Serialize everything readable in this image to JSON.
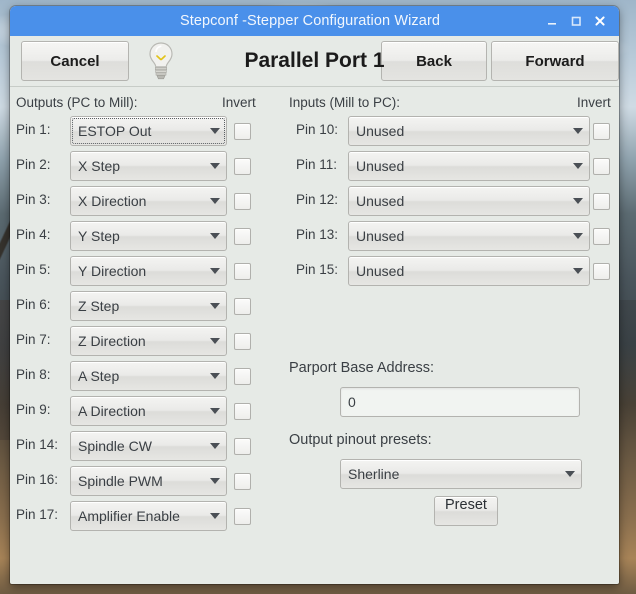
{
  "window": {
    "title": "Stepconf -Stepper Configuration Wizard",
    "minimize_label": "minimize",
    "maximize_label": "maximize",
    "close_label": "close",
    "titlebar_color": "#4a90ea",
    "panel_color": "#e6eae6"
  },
  "toolbar": {
    "cancel_label": "Cancel",
    "back_label": "Back",
    "forward_label": "Forward",
    "page_title": "Parallel Port 1",
    "bulb_icon": "lightbulb-icon"
  },
  "outputs": {
    "heading": "Outputs (PC to Mill):",
    "invert_heading": "Invert",
    "rows": [
      {
        "pin": "Pin 1:",
        "value": "ESTOP Out",
        "invert": false,
        "focused": true
      },
      {
        "pin": "Pin 2:",
        "value": "X Step",
        "invert": false,
        "focused": false
      },
      {
        "pin": "Pin 3:",
        "value": "X Direction",
        "invert": false,
        "focused": false
      },
      {
        "pin": "Pin 4:",
        "value": "Y Step",
        "invert": false,
        "focused": false
      },
      {
        "pin": "Pin 5:",
        "value": "Y Direction",
        "invert": false,
        "focused": false
      },
      {
        "pin": "Pin 6:",
        "value": "Z Step",
        "invert": false,
        "focused": false
      },
      {
        "pin": "Pin 7:",
        "value": "Z Direction",
        "invert": false,
        "focused": false
      },
      {
        "pin": "Pin 8:",
        "value": "A Step",
        "invert": false,
        "focused": false
      },
      {
        "pin": "Pin 9:",
        "value": "A Direction",
        "invert": false,
        "focused": false
      },
      {
        "pin": "Pin 14:",
        "value": "Spindle CW",
        "invert": false,
        "focused": false
      },
      {
        "pin": "Pin 16:",
        "value": "Spindle PWM",
        "invert": false,
        "focused": false
      },
      {
        "pin": "Pin 17:",
        "value": "Amplifier Enable",
        "invert": false,
        "focused": false
      }
    ]
  },
  "inputs": {
    "heading": "Inputs (Mill to PC):",
    "invert_heading": "Invert",
    "rows": [
      {
        "pin": "Pin 10:",
        "value": "Unused",
        "invert": false
      },
      {
        "pin": "Pin 11:",
        "value": "Unused",
        "invert": false
      },
      {
        "pin": "Pin 12:",
        "value": "Unused",
        "invert": false
      },
      {
        "pin": "Pin 13:",
        "value": "Unused",
        "invert": false
      },
      {
        "pin": "Pin 15:",
        "value": "Unused",
        "invert": false
      }
    ]
  },
  "parport": {
    "base_address_label": "Parport Base Address:",
    "base_address_value": "0",
    "presets_label": "Output pinout presets:",
    "preset_selected": "Sherline",
    "preset_button_label": "Preset"
  }
}
